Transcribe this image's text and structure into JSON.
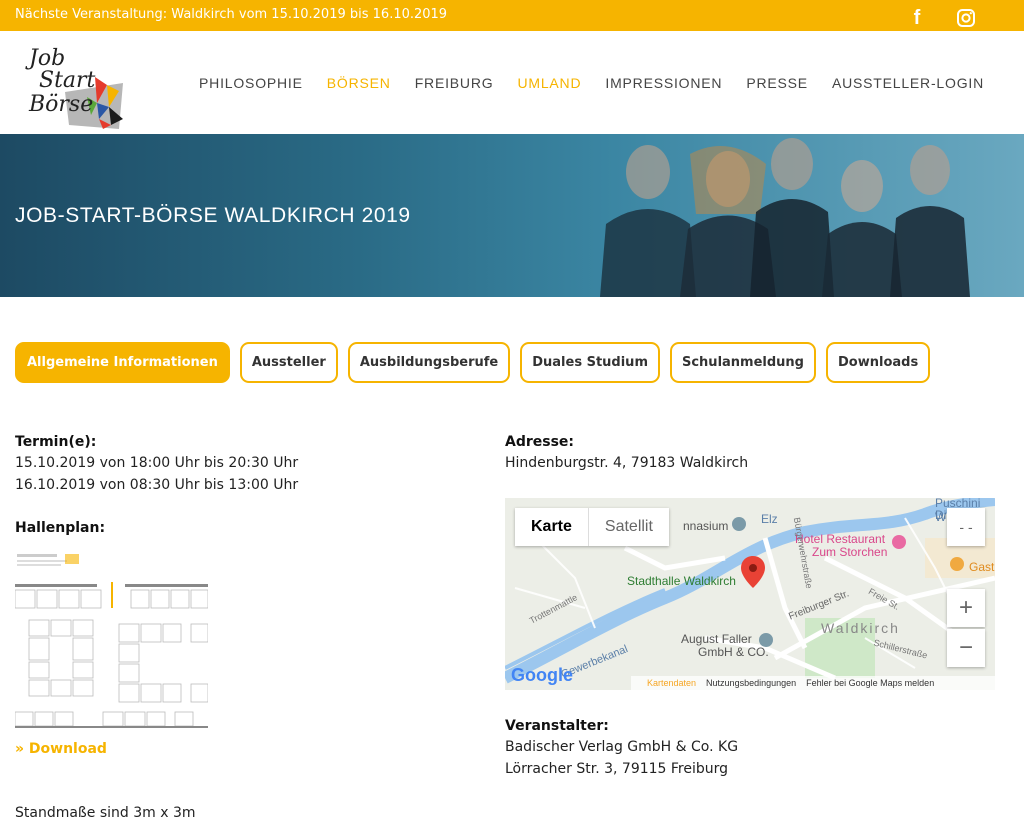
{
  "topbar": {
    "announcement": "Nächste Veranstaltung: Waldkirch vom 15.10.2019 bis 16.10.2019",
    "social": [
      "facebook-icon",
      "instagram-icon"
    ],
    "fb_glyph": "f"
  },
  "brand": {
    "logo_line1": "Job",
    "logo_line2": "Start",
    "logo_line3": "Börse"
  },
  "nav": {
    "items": [
      {
        "label": "PHILOSOPHIE",
        "active": false
      },
      {
        "label": "BÖRSEN",
        "active": true
      },
      {
        "label": "FREIBURG",
        "active": false
      },
      {
        "label": "UMLAND",
        "active": true
      },
      {
        "label": "IMPRESSIONEN",
        "active": false
      },
      {
        "label": "PRESSE",
        "active": false
      },
      {
        "label": "AUSSTELLER-LOGIN",
        "active": false
      }
    ]
  },
  "hero": {
    "title": "JOB-START-BÖRSE WALDKIRCH 2019"
  },
  "tabs": [
    {
      "label": "Allgemeine Informationen",
      "active": true
    },
    {
      "label": "Aussteller",
      "active": false
    },
    {
      "label": "Ausbildungsberufe",
      "active": false
    },
    {
      "label": "Duales Studium",
      "active": false
    },
    {
      "label": "Schulanmeldung",
      "active": false
    },
    {
      "label": "Downloads",
      "active": false
    }
  ],
  "termine": {
    "label": "Termin(e):",
    "lines": [
      "15.10.2019 von 18:00 Uhr bis 20:30 Uhr",
      "16.10.2019 von 08:30 Uhr bis 13:00 Uhr"
    ]
  },
  "hallenplan": {
    "label": "Hallenplan:",
    "download": "» Download"
  },
  "standmasse": "Standmaße sind 3m x 3m",
  "adresse": {
    "label": "Adresse:",
    "value": "Hindenburgstr. 4, 79183 Waldkirch"
  },
  "map": {
    "tab_karte": "Karte",
    "tab_satellit": "Satellit",
    "zoom_in": "+",
    "zoom_out": "−",
    "fullscreen": "- -",
    "labels": {
      "stadthalle": "Stadthalle Waldkirch",
      "hotel_line1": "Hotel Restaurant",
      "hotel_line2": "Zum Storchen",
      "august_line1": "August Faller",
      "august_line2": "GmbH & CO.",
      "waldkirch": "Waldkirch",
      "gymnasium": "nnasium",
      "puschini_line1": "Puschini W",
      "puschini_line2": "Di",
      "freiburger": "Freiburger Str.",
      "gast": "Gast",
      "elz": "Elz",
      "trottenmattle": "Trottenmattle",
      "schillerstrasse": "Schillerstraße",
      "freie": "Freie St.",
      "gewerbekanal": "Gewerbekanal",
      "burger": "Bürgerwehrstraße"
    },
    "google": "Google",
    "footer": {
      "kartendaten": "Kartendaten",
      "nutzung": "Nutzungsbedingungen",
      "fehler": "Fehler bei Google Maps melden"
    }
  },
  "veranstalter": {
    "label": "Veranstalter:",
    "lines": [
      "Badischer Verlag GmbH & Co. KG",
      "Lörracher Str. 3, 79115 Freiburg"
    ]
  },
  "colors": {
    "accent": "#f6b400",
    "hero": "#2a6b86"
  }
}
